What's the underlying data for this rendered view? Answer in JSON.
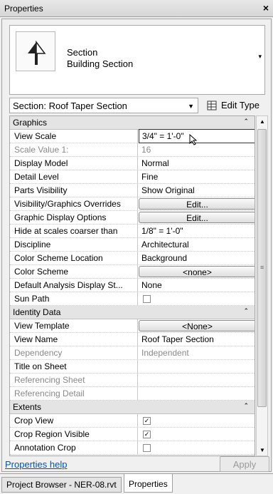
{
  "window": {
    "title": "Properties",
    "close_glyph": "×"
  },
  "type_selector": {
    "icon": "section-view-icon",
    "family": "Section",
    "type": "Building Section",
    "arrow": "▾"
  },
  "instance_selector": {
    "value": "Section: Roof Taper Section",
    "arrow": "▼"
  },
  "edit_type": {
    "label": "Edit Type",
    "icon": "edit-type-icon"
  },
  "groups": {
    "graphics": "Graphics",
    "identity": "Identity Data",
    "extents": "Extents",
    "collapse_glyph": "⌃"
  },
  "graphics": {
    "view_scale": {
      "label": "View Scale",
      "value": "3/4\" = 1'-0\""
    },
    "scale_value": {
      "label": "Scale Value    1:",
      "value": "16"
    },
    "display_model": {
      "label": "Display Model",
      "value": "Normal"
    },
    "detail_level": {
      "label": "Detail Level",
      "value": "Fine"
    },
    "parts_visibility": {
      "label": "Parts Visibility",
      "value": "Show Original"
    },
    "vg_overrides": {
      "label": "Visibility/Graphics Overrides",
      "value": "Edit..."
    },
    "graphic_display": {
      "label": "Graphic Display Options",
      "value": "Edit..."
    },
    "hide_scales": {
      "label": "Hide at scales coarser than",
      "value": "1/8\" = 1'-0\""
    },
    "discipline": {
      "label": "Discipline",
      "value": "Architectural"
    },
    "color_scheme_location": {
      "label": "Color Scheme Location",
      "value": "Background"
    },
    "color_scheme": {
      "label": "Color Scheme",
      "value": "<none>"
    },
    "default_analysis": {
      "label": "Default Analysis Display St...",
      "value": "None"
    },
    "sun_path": {
      "label": "Sun Path",
      "checked": false
    }
  },
  "identity": {
    "view_template": {
      "label": "View Template",
      "value": "<None>"
    },
    "view_name": {
      "label": "View Name",
      "value": "Roof Taper Section"
    },
    "dependency": {
      "label": "Dependency",
      "value": "Independent"
    },
    "title_on_sheet": {
      "label": "Title on Sheet",
      "value": ""
    },
    "referencing_sheet": {
      "label": "Referencing Sheet",
      "value": ""
    },
    "referencing_detail": {
      "label": "Referencing Detail",
      "value": ""
    }
  },
  "extents": {
    "crop_view": {
      "label": "Crop View",
      "checked": true
    },
    "crop_region_visible": {
      "label": "Crop Region Visible",
      "checked": true
    },
    "annotation_crop": {
      "label": "Annotation Crop",
      "checked": false
    }
  },
  "footer": {
    "help": "Properties help",
    "apply": "Apply"
  },
  "tabs": {
    "project_browser": "Project Browser - NER-08.rvt",
    "properties": "Properties"
  },
  "scrollbar": {
    "up": "▲",
    "down": "▼",
    "grip": "≡"
  },
  "checkmark": "✓"
}
